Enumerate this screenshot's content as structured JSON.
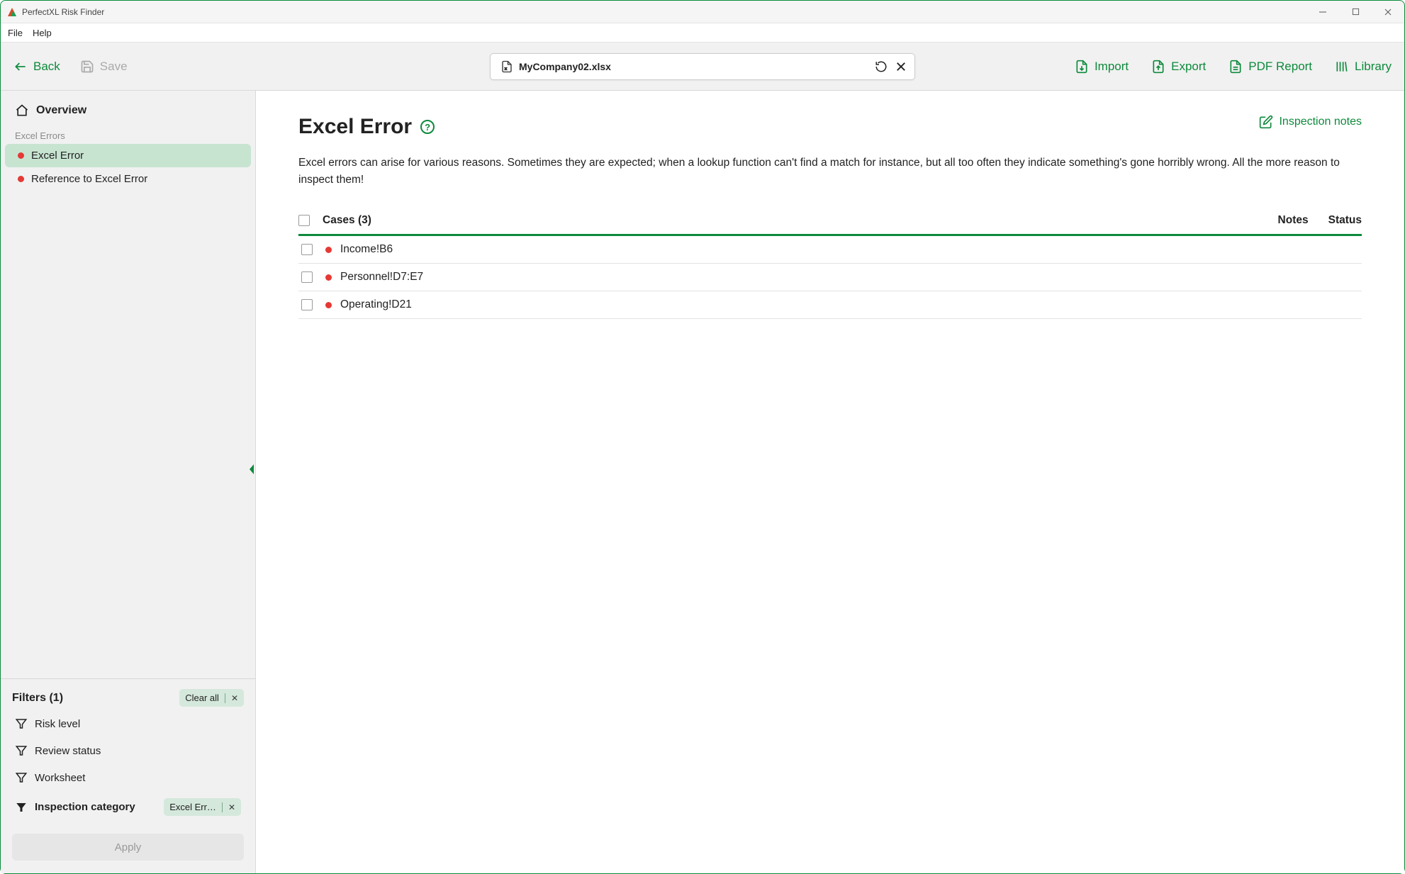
{
  "app": {
    "title": "PerfectXL Risk Finder"
  },
  "menu": {
    "file": "File",
    "help": "Help"
  },
  "toolbar": {
    "back": "Back",
    "save": "Save",
    "filename": "MyCompany02.xlsx",
    "import": "Import",
    "export": "Export",
    "pdf_report": "PDF Report",
    "library": "Library"
  },
  "sidebar": {
    "overview": "Overview",
    "section_label": "Excel Errors",
    "items": [
      {
        "label": "Excel Error",
        "active": true
      },
      {
        "label": "Reference to Excel Error",
        "active": false
      }
    ]
  },
  "filters": {
    "title": "Filters (1)",
    "clear_all": "Clear all",
    "risk_level": "Risk level",
    "review_status": "Review status",
    "worksheet": "Worksheet",
    "inspection_category": "Inspection category",
    "inspection_chip": "Excel Err…",
    "apply": "Apply"
  },
  "main": {
    "title": "Excel Error",
    "inspection_notes": "Inspection notes",
    "description": "Excel errors can arise for various reasons. Sometimes they are expected; when a lookup function can't find a match for instance, but all too often they indicate something's gone horribly wrong. All the more reason to inspect them!",
    "cases_label": "Cases (3)",
    "col_notes": "Notes",
    "col_status": "Status",
    "cases": [
      {
        "label": "Income!B6"
      },
      {
        "label": "Personnel!D7:E7"
      },
      {
        "label": "Operating!D21"
      }
    ]
  }
}
